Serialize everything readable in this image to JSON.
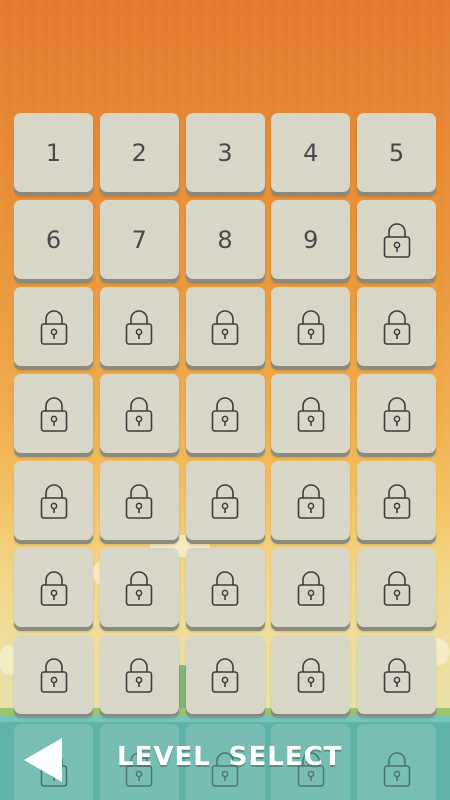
{
  "screen": {
    "title_words": [
      "LEVEL",
      "SELECT"
    ]
  },
  "colors": {
    "tile": "#d8d6c6",
    "tile_shadow": "#8b8a7c",
    "text": "#4a4a4a",
    "sky_top": "#e3782a",
    "water": "#5fb3a8"
  },
  "levels": [
    {
      "label": "1",
      "locked": false
    },
    {
      "label": "2",
      "locked": false
    },
    {
      "label": "3",
      "locked": false
    },
    {
      "label": "4",
      "locked": false
    },
    {
      "label": "5",
      "locked": false
    },
    {
      "label": "6",
      "locked": false
    },
    {
      "label": "7",
      "locked": false
    },
    {
      "label": "8",
      "locked": false
    },
    {
      "label": "9",
      "locked": false
    },
    {
      "label": "",
      "locked": true
    },
    {
      "label": "",
      "locked": true
    },
    {
      "label": "",
      "locked": true
    },
    {
      "label": "",
      "locked": true
    },
    {
      "label": "",
      "locked": true
    },
    {
      "label": "",
      "locked": true
    },
    {
      "label": "",
      "locked": true
    },
    {
      "label": "",
      "locked": true
    },
    {
      "label": "",
      "locked": true
    },
    {
      "label": "",
      "locked": true
    },
    {
      "label": "",
      "locked": true
    },
    {
      "label": "",
      "locked": true
    },
    {
      "label": "",
      "locked": true
    },
    {
      "label": "",
      "locked": true
    },
    {
      "label": "",
      "locked": true
    },
    {
      "label": "",
      "locked": true
    },
    {
      "label": "",
      "locked": true
    },
    {
      "label": "",
      "locked": true
    },
    {
      "label": "",
      "locked": true
    },
    {
      "label": "",
      "locked": true
    },
    {
      "label": "",
      "locked": true
    },
    {
      "label": "",
      "locked": true
    },
    {
      "label": "",
      "locked": true
    },
    {
      "label": "",
      "locked": true
    },
    {
      "label": "",
      "locked": true
    },
    {
      "label": "",
      "locked": true
    },
    {
      "label": "",
      "locked": true
    },
    {
      "label": "",
      "locked": true
    },
    {
      "label": "",
      "locked": true
    },
    {
      "label": "",
      "locked": true
    },
    {
      "label": "",
      "locked": true
    }
  ],
  "bottom_partial_row_locked": [
    true,
    true,
    true,
    true,
    true
  ],
  "icons": {
    "back": "back-arrow-icon",
    "lock": "lock-icon"
  }
}
